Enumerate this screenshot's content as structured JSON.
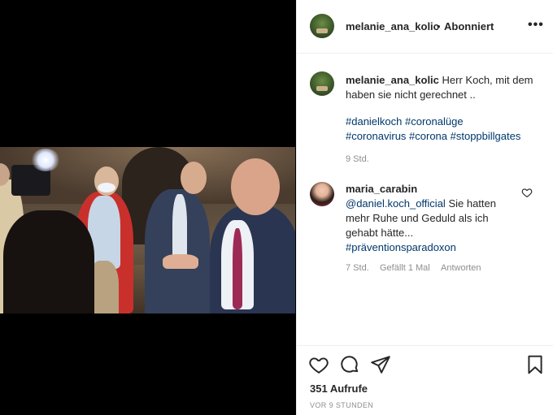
{
  "post": {
    "header": {
      "username": "melanie_ana_kolic",
      "separator": "•",
      "follow_status": "Abonniert",
      "more_icon": "more-horizontal-icon"
    },
    "caption": {
      "username": "melanie_ana_kolic",
      "text": "Herr Koch, mit dem haben sie nicht gerechnet ..",
      "hashtags_line1": "#danielkoch #coronalüge",
      "hashtags_line2": "#coronavirus #corona #stoppbillgates",
      "time": "9 Std."
    },
    "comments": [
      {
        "username": "maria_carabin",
        "mention": "@daniel.koch_official",
        "text": "Sie hatten mehr Ruhe und Geduld als ich gehabt hätte...",
        "hashtag": "#präventionsparadoxon",
        "time": "7 Std.",
        "likes": "Gefällt 1 Mal",
        "reply_label": "Antworten"
      }
    ],
    "actions": {
      "like_icon": "heart-icon",
      "comment_icon": "comment-icon",
      "share_icon": "share-icon",
      "save_icon": "bookmark-icon"
    },
    "views": "351 Aufrufe",
    "posted_ago": "VOR 9 STUNDEN"
  }
}
